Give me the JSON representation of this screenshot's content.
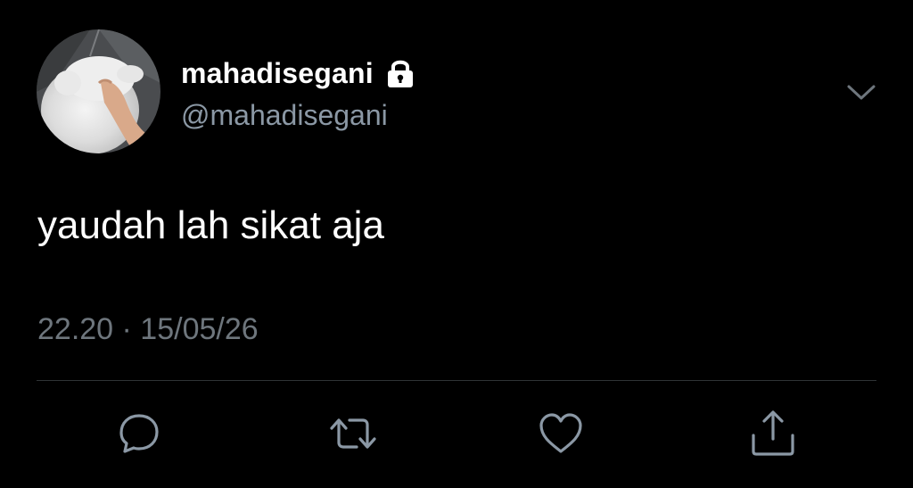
{
  "user": {
    "display_name": "mahadisegani",
    "handle": "@mahadisegani",
    "avatar_icon": "white-dog-being-petted-avatar",
    "protected_icon": "lock-icon"
  },
  "tweet": {
    "text": "yaudah lah sikat aja",
    "timestamp": "22.20 · 15/05/26"
  },
  "actions": {
    "reply_icon": "reply-icon",
    "retweet_icon": "retweet-icon",
    "like_icon": "heart-icon",
    "share_icon": "share-icon",
    "more_icon": "chevron-down-icon"
  },
  "colors": {
    "background": "#000000",
    "primary_text": "#ffffff",
    "secondary_text": "#8b98a5",
    "icon": "#8b98a5",
    "divider": "#2f3336"
  }
}
